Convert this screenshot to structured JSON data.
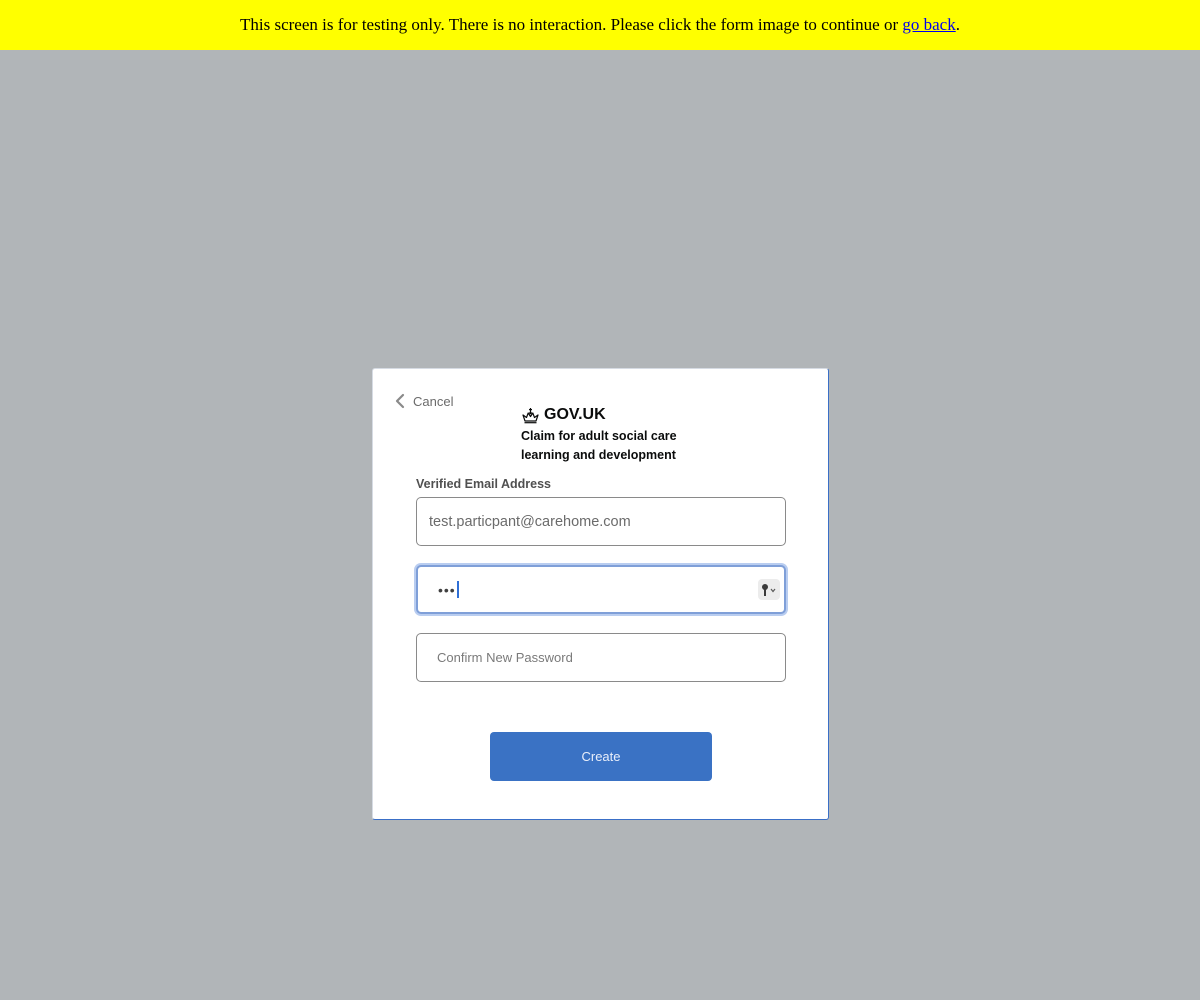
{
  "banner": {
    "text_before": "This screen is for testing only. There is no interaction. Please click the form image to continue or ",
    "link_text": "go back",
    "text_after": "."
  },
  "form": {
    "cancel_label": "Cancel",
    "brand_name": "GOV.UK",
    "service_name": "Claim for adult social care learning and development",
    "email_label": "Verified Email Address",
    "email_value": "test.particpant@carehome.com",
    "password_value": "•••",
    "confirm_placeholder": "Confirm New Password",
    "create_label": "Create"
  },
  "icons": {
    "cancel": "chevron-left-icon",
    "brand": "crown-icon",
    "password_manager": "key-icon"
  },
  "colors": {
    "banner_bg": "#ffff00",
    "page_bg": "#b1b5b8",
    "button_bg": "#3a72c4",
    "focus_ring": "#7f9fd8"
  }
}
